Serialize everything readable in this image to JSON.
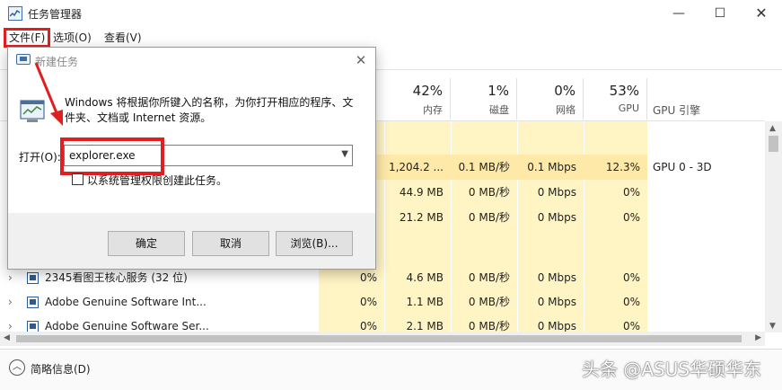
{
  "window": {
    "title": "任务管理器",
    "controls": {
      "minimize": "—",
      "maximize": "☐",
      "close": "✕"
    }
  },
  "menu": {
    "file": "文件(F)",
    "options": "选项(O)",
    "view": "查看(V)"
  },
  "columns": {
    "memory": {
      "pct": "42%",
      "label": "内存"
    },
    "disk": {
      "pct": "1%",
      "label": "磁盘"
    },
    "network": {
      "pct": "0%",
      "label": "网络"
    },
    "gpu": {
      "pct": "53%",
      "label": "GPU"
    },
    "gpu_engine": {
      "label": "GPU 引擎"
    }
  },
  "rows": [
    {
      "name": "",
      "cpu": "",
      "memory": "1,204.2 ...",
      "disk": "0.1 MB/秒",
      "network": "0.1 Mbps",
      "gpu": "12.3%",
      "gpu_engine": "GPU 0 - 3D"
    },
    {
      "name": "",
      "cpu": "",
      "memory": "44.9 MB",
      "disk": "0 MB/秒",
      "network": "0 Mbps",
      "gpu": "0%",
      "gpu_engine": ""
    },
    {
      "name": "",
      "cpu": "",
      "memory": "21.2 MB",
      "disk": "0 MB/秒",
      "network": "0 Mbps",
      "gpu": "0%",
      "gpu_engine": ""
    },
    {
      "name": "2345看图王核心服务 (32 位)",
      "cpu": "0%",
      "memory": "4.6 MB",
      "disk": "0 MB/秒",
      "network": "0 Mbps",
      "gpu": "0%",
      "gpu_engine": ""
    },
    {
      "name": "Adobe Genuine Software Int...",
      "cpu": "0%",
      "memory": "1.1 MB",
      "disk": "0 MB/秒",
      "network": "0 Mbps",
      "gpu": "0%",
      "gpu_engine": ""
    },
    {
      "name": "Adobe Genuine Software Ser...",
      "cpu": "0%",
      "memory": "2.1 MB",
      "disk": "0 MB/秒",
      "network": "0 Mbps",
      "gpu": "0%",
      "gpu_engine": ""
    }
  ],
  "footer": {
    "fewer_details": "简略信息(D)",
    "watermark": "头条 @ASUS华硕华东"
  },
  "dialog": {
    "title": "新建任务",
    "close": "✕",
    "description": "Windows 将根据你所键入的名称，为你打开相应的程序、文件夹、文档或 Internet 资源。",
    "open_label": "打开(O):",
    "open_value": "explorer.exe",
    "admin_checkbox_label": "以系统管理权限创建此任务。",
    "admin_checked": false,
    "ok": "确定",
    "cancel": "取消",
    "browse": "浏览(B)..."
  },
  "colors": {
    "heat_light": "#fff4c4",
    "heat_highlight": "#ffe9a8",
    "annotation_red": "#e02020"
  }
}
